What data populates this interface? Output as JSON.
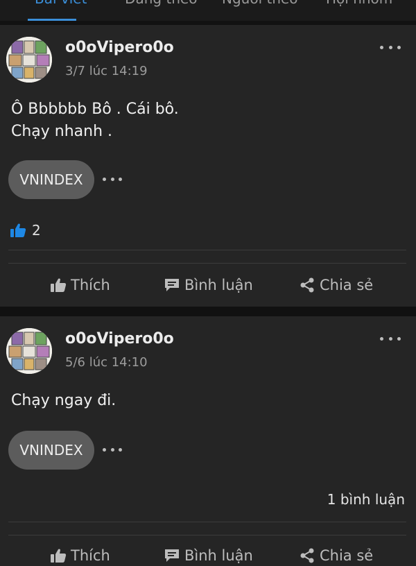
{
  "top_tabs": [
    "Bài viết",
    "Đang theo",
    "Người theo",
    "Hội nhóm"
  ],
  "colors": {
    "background": "#121212",
    "card": "#252525",
    "tag_bg": "#5c5c5c",
    "like_blue": "#1e88e5",
    "accent": "#3b8fd9"
  },
  "posts": [
    {
      "author": "o0oVipero0o",
      "timestamp": "3/7 lúc 14:19",
      "content_lines": [
        "Ô Bbbbbb Bô . Cái bô.",
        "Chạy nhanh ."
      ],
      "tag": "VNINDEX",
      "likes": "2",
      "actions": {
        "like": "Thích",
        "comment": "Bình luận",
        "share": "Chia sẻ"
      }
    },
    {
      "author": "o0oVipero0o",
      "timestamp": "5/6 lúc 14:10",
      "content_lines": [
        "Chạy ngay đi."
      ],
      "tag": "VNINDEX",
      "comment_count": "1 bình luận",
      "actions": {
        "like": "Thích",
        "comment": "Bình luận",
        "share": "Chia sẻ"
      }
    }
  ],
  "icons": {
    "avatar": "comic-panel-avatar",
    "more": "more-horizontal-icon",
    "like": "thumbs-up-icon",
    "comment": "comment-bubble-icon",
    "share": "share-icon"
  }
}
